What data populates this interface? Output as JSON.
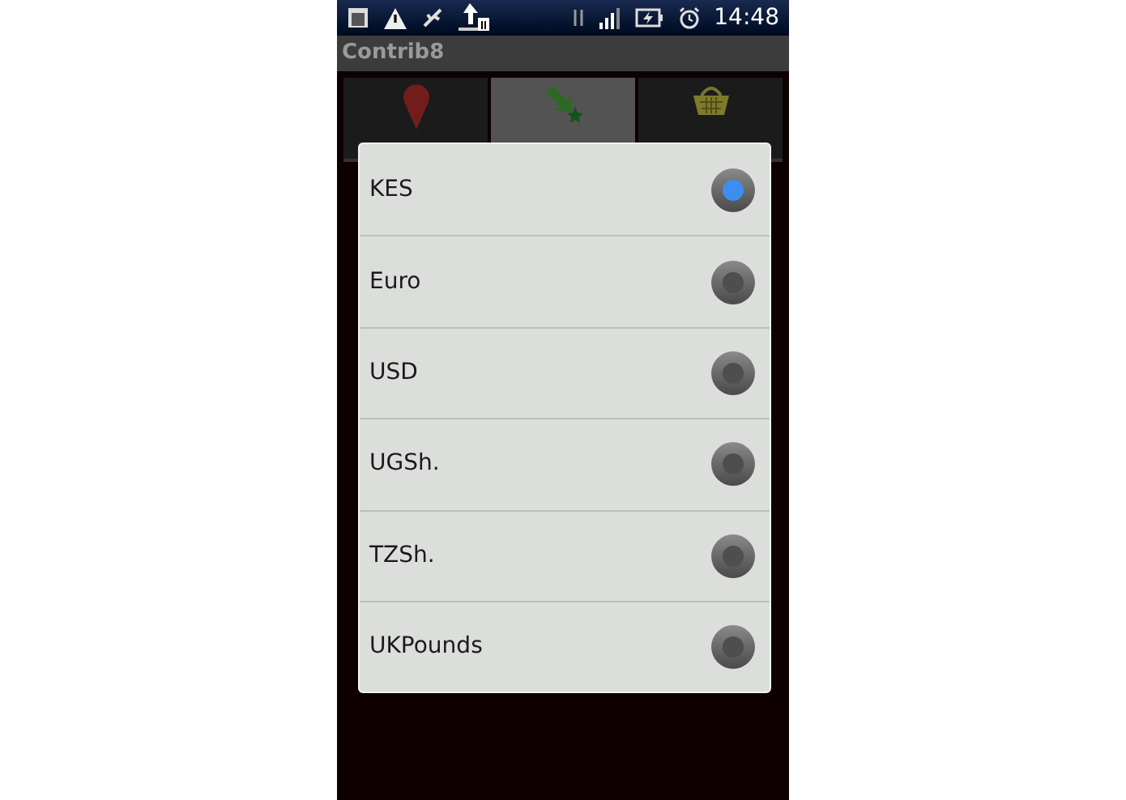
{
  "status_bar": {
    "time": "14:48"
  },
  "title_bar": {
    "title": "Contrib8"
  },
  "tabs": [
    {
      "kind": "pin",
      "selected": false
    },
    {
      "kind": "arrow",
      "selected": true
    },
    {
      "kind": "basket",
      "selected": false
    }
  ],
  "dialog": {
    "options": [
      {
        "label": "KES",
        "selected": true
      },
      {
        "label": "Euro",
        "selected": false
      },
      {
        "label": "USD",
        "selected": false
      },
      {
        "label": "UGSh.",
        "selected": false
      },
      {
        "label": "TZSh.",
        "selected": false
      },
      {
        "label": "UKPounds",
        "selected": false
      }
    ]
  }
}
